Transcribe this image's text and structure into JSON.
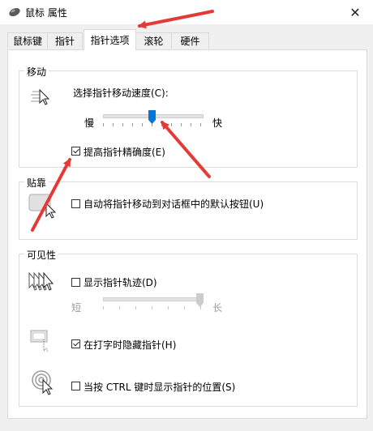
{
  "window": {
    "title": "鼠标 属性"
  },
  "tabs": [
    {
      "label": "鼠标键"
    },
    {
      "label": "指针"
    },
    {
      "label": "指针选项",
      "selected": true
    },
    {
      "label": "滚轮"
    },
    {
      "label": "硬件"
    }
  ],
  "motion": {
    "title": "移动",
    "speed_label": "选择指针移动速度(C):",
    "slow": "慢",
    "fast": "快",
    "speed_value_fraction": 0.5,
    "enhance_precision": {
      "label": "提高指针精确度(E)",
      "checked": true
    }
  },
  "snap": {
    "title": "贴靠",
    "snap_to": {
      "label": "自动将指针移动到对话框中的默认按钮(U)",
      "checked": false
    }
  },
  "visibility": {
    "title": "可见性",
    "trails": {
      "label": "显示指针轨迹(D)",
      "checked": false
    },
    "short": "短",
    "long": "长",
    "trail_length_fraction": 1.0,
    "hide_while_typing": {
      "label": "在打字时隐藏指针(H)",
      "checked": true
    },
    "show_location": {
      "label": "当按 CTRL 键时显示指针的位置(S)",
      "checked": false
    }
  },
  "colors": {
    "accent": "#0078d7",
    "annotation": "#e53935"
  }
}
